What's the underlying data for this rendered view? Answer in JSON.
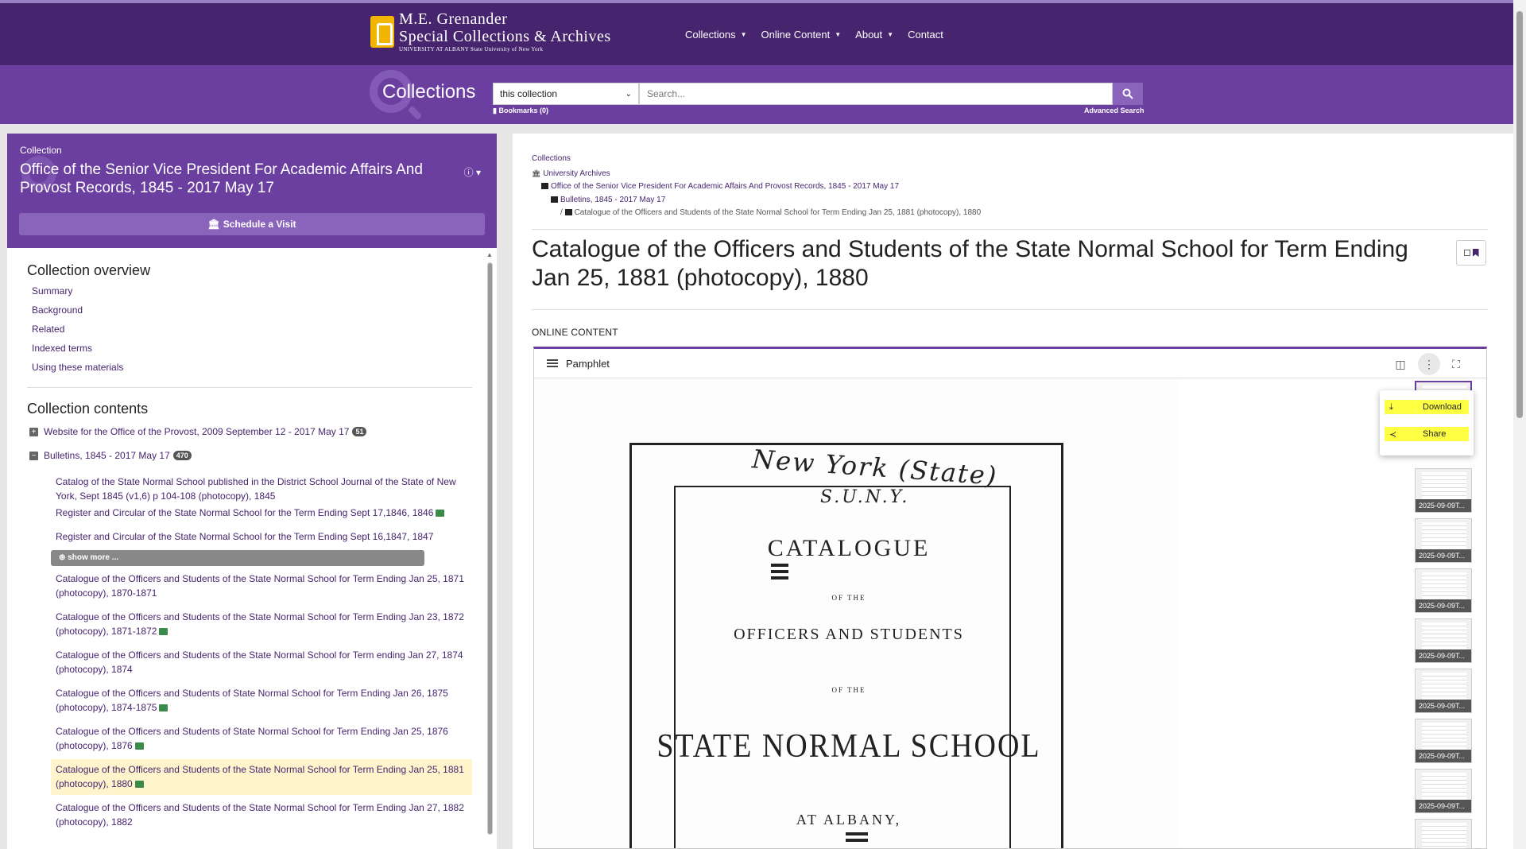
{
  "header": {
    "logo": {
      "line1": "M.E. Grenander",
      "line2": "Special Collections & Archives",
      "line3": "UNIVERSITY AT ALBANY State University of New York"
    },
    "nav": [
      {
        "label": "Collections",
        "has_caret": true
      },
      {
        "label": "Online Content",
        "has_caret": true
      },
      {
        "label": "About",
        "has_caret": true
      },
      {
        "label": "Contact",
        "has_caret": false
      }
    ]
  },
  "search": {
    "section_title": "Collections",
    "scope_value": "this collection",
    "placeholder": "Search...",
    "bookmarks_label": "Bookmarks (0)",
    "advanced_label": "Advanced Search"
  },
  "collection": {
    "eyebrow": "Collection",
    "title": "Office of the Senior Vice President For Academic Affairs And Provost Records, 1845 - 2017 May 17",
    "visit_button": "Schedule a Visit",
    "overview_heading": "Collection overview",
    "overview_links": [
      "Summary",
      "Background",
      "Related",
      "Indexed terms",
      "Using these materials"
    ],
    "contents_heading": "Collection contents",
    "series": [
      {
        "label": "Website for the Office of the Provost, 2009 September 12 - 2017 May 17",
        "count": "51",
        "expanded": false
      },
      {
        "label": "Bulletins, 1845 - 2017 May 17",
        "count": "470",
        "expanded": true
      }
    ],
    "children": [
      {
        "label": "Catalog of the State Normal School published in the District School Journal of the State of New York, Sept 1845 (v1,6) p 104-108 (photocopy), 1845",
        "has_image": false,
        "active": false
      },
      {
        "label": "Register and Circular of the State Normal School for the Term Ending Sept 17,1846, 1846",
        "has_image": true,
        "active": false
      },
      {
        "label": "Register and Circular of the State Normal School for the Term Ending Sept 16,1847, 1847",
        "has_image": false,
        "active": false
      },
      {
        "label": "Catalogue of the Officers and Students of the State Normal School for Term Ending Jan 25, 1871 (photocopy), 1870-1871",
        "has_image": false,
        "active": false
      },
      {
        "label": "Catalogue of the Officers and Students of the State Normal School for Term Ending Jan 23, 1872 (photocopy), 1871-1872",
        "has_image": true,
        "active": false
      },
      {
        "label": "Catalogue of the Officers and Students of the State Normal School for Term ending Jan 27, 1874 (photocopy), 1874",
        "has_image": false,
        "active": false
      },
      {
        "label": "Catalogue of the Officers and Students of State Normal School for Term Ending Jan 26, 1875 (photocopy), 1874-1875",
        "has_image": true,
        "active": false
      },
      {
        "label": "Catalogue of the Officers and Students of State Normal School for Term Ending Jan 25, 1876 (photocopy), 1876",
        "has_image": true,
        "active": false
      },
      {
        "label": "Catalogue of the Officers and Students of the State Normal School for Term Ending Jan 25, 1881 (photocopy), 1880",
        "has_image": true,
        "active": true
      },
      {
        "label": "Catalogue of the Officers and Students of the State Normal School for Term Ending Jan 27, 1882 (photocopy), 1882",
        "has_image": false,
        "active": false
      }
    ],
    "show_more": "show more ..."
  },
  "breadcrumbs": [
    "Collections",
    "University Archives",
    "Office of the Senior Vice President For Academic Affairs And Provost Records, 1845 - 2017 May 17",
    "Bulletins, 1845 - 2017 May 17",
    "Catalogue of the Officers and Students of the State Normal School for Term Ending Jan 25, 1881 (photocopy), 1880"
  ],
  "item": {
    "title": "Catalogue of the Officers and Students of the State Normal School for Term Ending Jan 25, 1881 (photocopy), 1880",
    "online_content_label": "ONLINE CONTENT"
  },
  "viewer": {
    "title": "Pamphlet",
    "menu": [
      "Download",
      "Share"
    ],
    "thumb_label": "2025-09-09T...",
    "thumb_count": 9,
    "scan": {
      "handwriting": "New York (State)",
      "handwriting2": "S.U.N.Y.",
      "line_catalogue": "CATALOGUE",
      "line_of_the": "OF THE",
      "line_officers": "OFFICERS AND STUDENTS",
      "line_of_the2": "OF THE",
      "line_school": "STATE NORMAL SCHOOL",
      "line_albany": "AT ALBANY,"
    }
  },
  "colors": {
    "brand_dark": "#46246e",
    "brand": "#6b3fa0",
    "brand_light": "#8a63bb",
    "highlight": "#ffff44",
    "active_row": "#fff5cc"
  }
}
